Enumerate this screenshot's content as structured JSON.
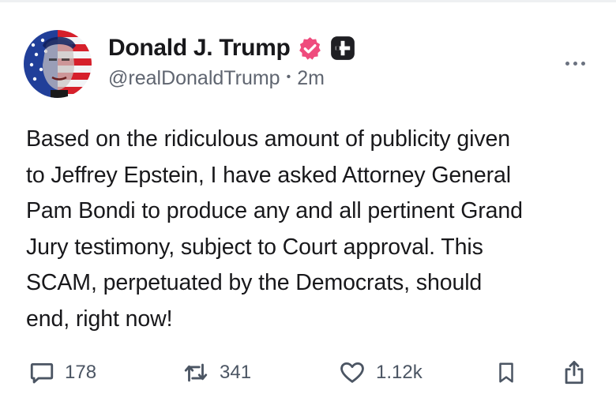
{
  "author": {
    "display_name": "Donald J. Trump",
    "handle": "@realDonaldTrump",
    "separator": "•",
    "time_ago": "2m",
    "verified_icon": "verified-badge-icon",
    "verified_color": "#ef4b7d",
    "plus_icon": "plus-badge-icon"
  },
  "post": {
    "lines": [
      "Based on the ridiculous amount of publicity given",
      "to Jeffrey Epstein, I have asked Attorney General",
      "Pam Bondi to produce any and all pertinent Grand",
      "Jury testimony, subject to Court approval. This",
      "SCAM, perpetuated by the Democrats, should",
      "end, right now!"
    ]
  },
  "actions": {
    "replies": {
      "icon": "comment-icon",
      "count": "178"
    },
    "reposts": {
      "icon": "repost-icon",
      "count": "341"
    },
    "likes": {
      "icon": "heart-icon",
      "count": "1.12k"
    },
    "bookmark": {
      "icon": "bookmark-icon"
    },
    "share": {
      "icon": "share-icon"
    }
  },
  "more_menu": {
    "icon": "more-horizontal-icon"
  }
}
